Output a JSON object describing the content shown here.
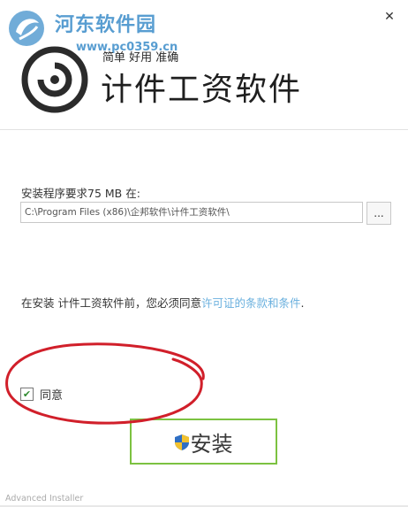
{
  "window": {
    "close_glyph": "✕"
  },
  "watermark": {
    "title": "河东软件园",
    "url": "www.pc0359.cn",
    "accent": "#3b8dc9"
  },
  "header": {
    "tagline": "简单 好用 准确",
    "title": "计件工资软件"
  },
  "install_location": {
    "label": "安装程序要求75 MB 在:",
    "path_value": "C:\\Program Files (x86)\\企邦软件\\计件工资软件\\",
    "browse_label": "..."
  },
  "license": {
    "prefix": "在安装 计件工资软件前，您必须同意",
    "link_text": "许可证的条款和条件",
    "suffix": ".",
    "link_color": "#6ab0de"
  },
  "agree": {
    "checked": true,
    "check_glyph": "✔",
    "label": "同意"
  },
  "install": {
    "label": "安装",
    "border_color": "#7cc241"
  },
  "footer": {
    "text": "Advanced Installer"
  },
  "annotation_color": "#d11f2a"
}
